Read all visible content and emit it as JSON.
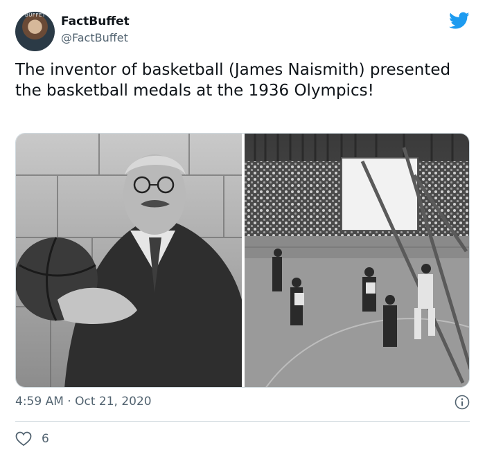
{
  "tweet": {
    "display_name": "FactBuffet",
    "handle": "@FactBuffet",
    "text": "The inventor of basketball (James Naismith) presented the basketball medals at the 1936 Olympics!",
    "timestamp": "4:59 AM · Oct 21, 2020",
    "like_count": "6"
  },
  "icons": {
    "platform": "twitter-bird-icon",
    "info": "info-icon",
    "like": "heart-icon"
  },
  "colors": {
    "brand_blue": "#1d9bf0",
    "secondary_text": "#536471",
    "divider": "#cfd9de"
  }
}
